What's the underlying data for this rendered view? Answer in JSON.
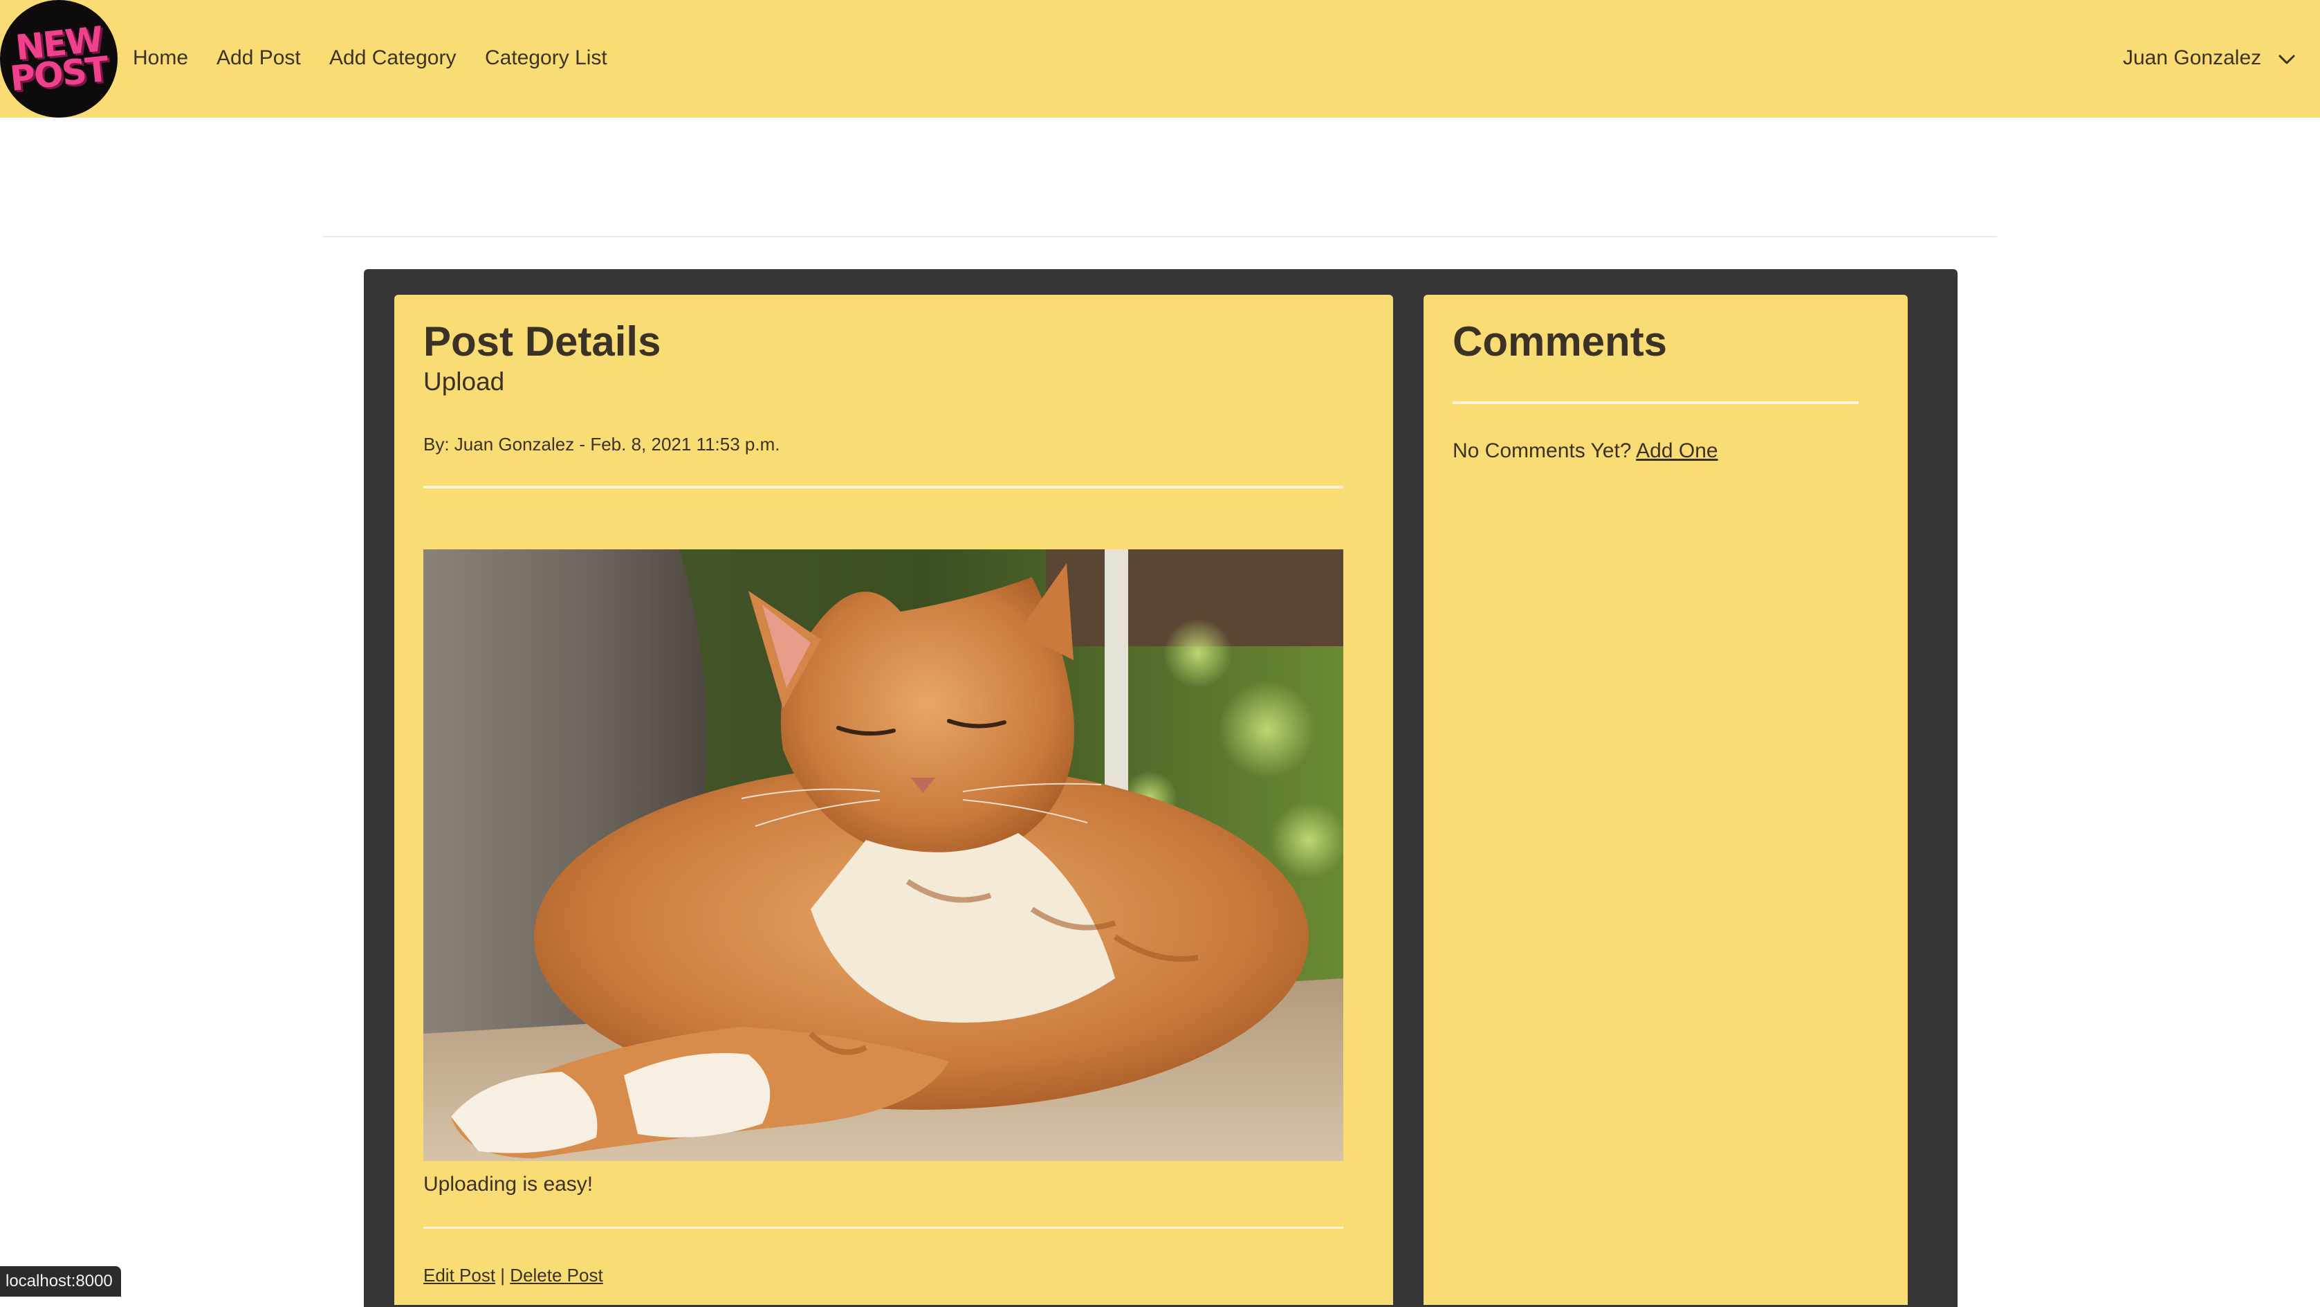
{
  "navbar": {
    "logo_text_line1": "NEW",
    "logo_text_line2": "POST",
    "links": [
      {
        "label": "Home"
      },
      {
        "label": "Add Post"
      },
      {
        "label": "Add Category"
      },
      {
        "label": "Category List"
      }
    ],
    "user_name": "Juan Gonzalez",
    "user_menu_icon": "chevron-down-icon"
  },
  "post": {
    "heading": "Post Details",
    "title": "Upload",
    "meta": "By: Juan Gonzalez - Feb. 8, 2021 11:53 p.m.",
    "image_subject": "cat-photo",
    "body": "Uploading is easy!",
    "edit_label": "Edit Post",
    "separator": "|",
    "delete_label": "Delete Post"
  },
  "comments": {
    "heading": "Comments",
    "empty_text": "No Comments Yet?",
    "add_label": "Add One"
  },
  "status_bar": {
    "url": "localhost:8000"
  },
  "colors": {
    "navbar_bg": "#fadc74",
    "card_bg": "#fadc74",
    "wrapper_bg": "#363636",
    "text": "#3a3226",
    "logo_bg": "#0d0b0c",
    "logo_text": "#f0418c"
  }
}
